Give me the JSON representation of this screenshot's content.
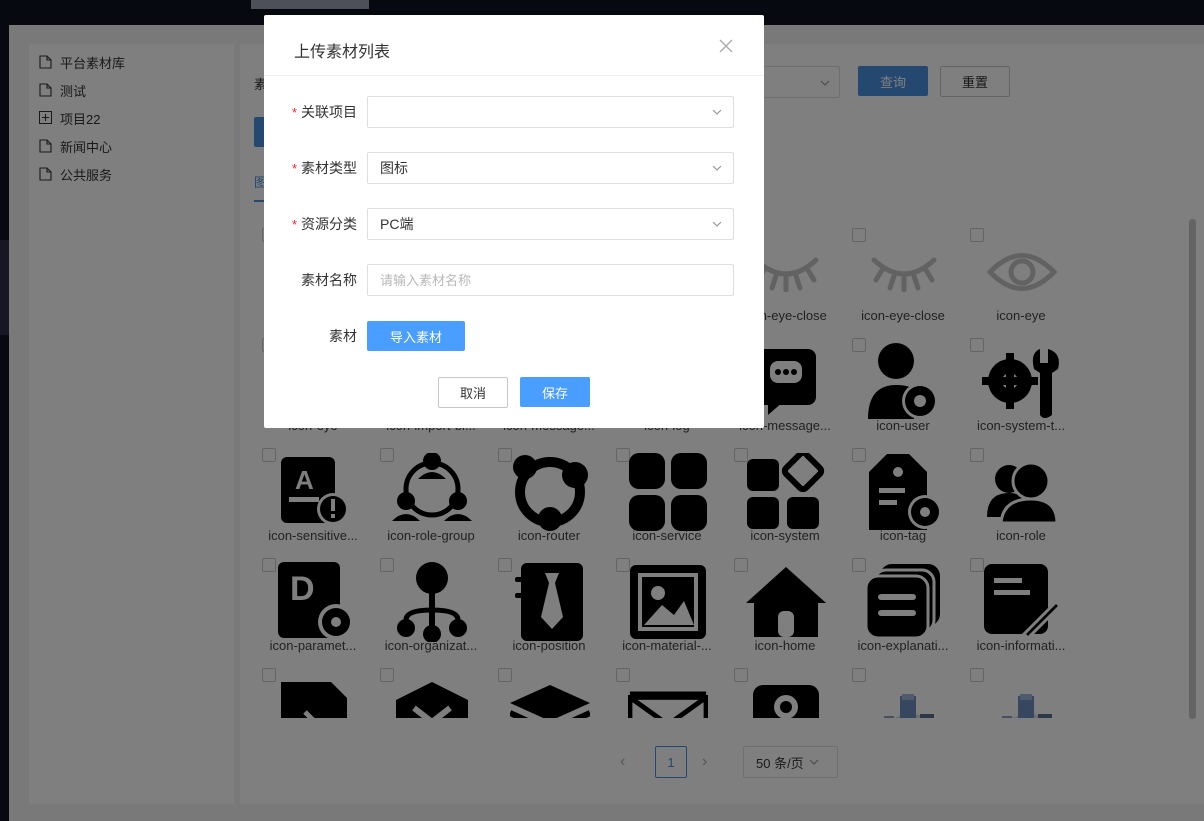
{
  "sidebar": {
    "items": [
      {
        "label": "平台素材库",
        "icon": "file-icon"
      },
      {
        "label": "测试",
        "icon": "file-icon"
      },
      {
        "label": "项目22",
        "icon": "expand-plus-icon"
      },
      {
        "label": "新闻中心",
        "icon": "file-icon"
      },
      {
        "label": "公共服务",
        "icon": "file-icon"
      }
    ]
  },
  "toolbar": {
    "filter_label": "素",
    "query_label": "查询",
    "reset_label": "重置",
    "tab_label": "图"
  },
  "grid": {
    "icons": [
      {
        "name": "",
        "glyph": "hidden"
      },
      {
        "name": "",
        "glyph": "hidden"
      },
      {
        "name": "",
        "glyph": "hidden"
      },
      {
        "name": "",
        "glyph": "hidden"
      },
      {
        "name": "icon-eye-close",
        "glyph": "eye-close"
      },
      {
        "name": "icon-eye-close",
        "glyph": "eye-close"
      },
      {
        "name": "icon-eye",
        "glyph": "eye"
      },
      {
        "name": "icon-eye",
        "glyph": "hidden"
      },
      {
        "name": "icon-import-bl...",
        "glyph": "hidden"
      },
      {
        "name": "icon-message...",
        "glyph": "hidden"
      },
      {
        "name": "icon-log",
        "glyph": "hidden"
      },
      {
        "name": "icon-message...",
        "glyph": "message"
      },
      {
        "name": "icon-user",
        "glyph": "user-gear"
      },
      {
        "name": "icon-system-t...",
        "glyph": "gear-wrench"
      },
      {
        "name": "icon-sensitive...",
        "glyph": "sensitive"
      },
      {
        "name": "icon-role-group",
        "glyph": "role-group"
      },
      {
        "name": "icon-router",
        "glyph": "router"
      },
      {
        "name": "icon-service",
        "glyph": "service"
      },
      {
        "name": "icon-system",
        "glyph": "system"
      },
      {
        "name": "icon-tag",
        "glyph": "tag"
      },
      {
        "name": "icon-role",
        "glyph": "role"
      },
      {
        "name": "icon-paramet...",
        "glyph": "parameter"
      },
      {
        "name": "icon-organizat...",
        "glyph": "organization"
      },
      {
        "name": "icon-position",
        "glyph": "position"
      },
      {
        "name": "icon-material-...",
        "glyph": "image"
      },
      {
        "name": "icon-home",
        "glyph": "home"
      },
      {
        "name": "icon-explanati...",
        "glyph": "explanation"
      },
      {
        "name": "icon-informati...",
        "glyph": "information"
      },
      {
        "name": "",
        "glyph": "code"
      },
      {
        "name": "",
        "glyph": "box"
      },
      {
        "name": "",
        "glyph": "layers"
      },
      {
        "name": "",
        "glyph": "mail"
      },
      {
        "name": "",
        "glyph": "key"
      },
      {
        "name": "",
        "glyph": "machine"
      },
      {
        "name": "",
        "glyph": "machine"
      }
    ]
  },
  "pagination": {
    "prev": "‹",
    "current": "1",
    "next": "›",
    "page_size": "50 条/页"
  },
  "dialog": {
    "title": "上传素材列表",
    "fields": {
      "project": {
        "label": "关联项目",
        "value": "",
        "required": true
      },
      "type": {
        "label": "素材类型",
        "value": "图标",
        "required": true
      },
      "category": {
        "label": "资源分类",
        "value": "PC端",
        "required": true
      },
      "name": {
        "label": "素材名称",
        "placeholder": "请输入素材名称",
        "value": ""
      },
      "material": {
        "label": "素材",
        "button": "导入素材"
      }
    },
    "required_mark": "*",
    "cancel_label": "取消",
    "save_label": "保存"
  },
  "colors": {
    "primary": "#4a9eff",
    "required": "#f5222d",
    "mask": "rgba(0,0,0,0.5)"
  }
}
